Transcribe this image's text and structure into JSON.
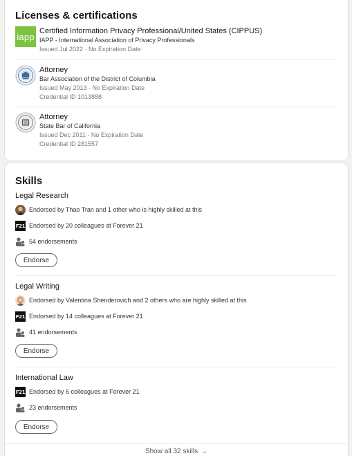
{
  "licenses": {
    "title": "Licenses & certifications",
    "items": [
      {
        "logo_text": "iapp",
        "title": "Certified Information Privacy Professional/United States (CIPPUS)",
        "issuer": "IAPP - International Association of Privacy Professionals",
        "issued": "Issued Jul 2022 · No Expiration Date",
        "credential": ""
      },
      {
        "title": "Attorney",
        "issuer": "Bar Association of the District of Columbia",
        "issued": "Issued May 2013 · No Expiration Date",
        "credential": "Credential ID 1013888"
      },
      {
        "title": "Attorney",
        "issuer": "State Bar of California",
        "issued": "Issued Dec 2011 · No Expiration Date",
        "credential": "Credential ID 281557"
      }
    ]
  },
  "skills": {
    "title": "Skills",
    "items": [
      {
        "name": "Legal Research",
        "endorsed_by_person": "Endorsed by Thao Tran and 1 other who is highly skilled at this",
        "endorsed_by_company": "Endorsed by 20 colleagues at Forever 21",
        "endorsements": "54 endorsements",
        "button": "Endorse"
      },
      {
        "name": "Legal Writing",
        "endorsed_by_person": "Endorsed by Valentina Shenderovich and 2 others who are highly skilled at this",
        "endorsed_by_company": "Endorsed by 14 colleagues at Forever 21",
        "endorsements": "41 endorsements",
        "button": "Endorse"
      },
      {
        "name": "International Law",
        "endorsed_by_company": "Endorsed by 6 colleagues at Forever 21",
        "endorsements": "23 endorsements",
        "button": "Endorse"
      }
    ],
    "company_logo_text": "F21",
    "show_all": "Show all 32 skills"
  },
  "colors": {
    "background": "#f4f2ee",
    "iapp_green": "#7dc242",
    "card": "#ffffff"
  },
  "icons": {
    "company": "forever21-logo",
    "endorsement_count": "people-icon",
    "show_all_arrow": "arrow-right-icon"
  }
}
